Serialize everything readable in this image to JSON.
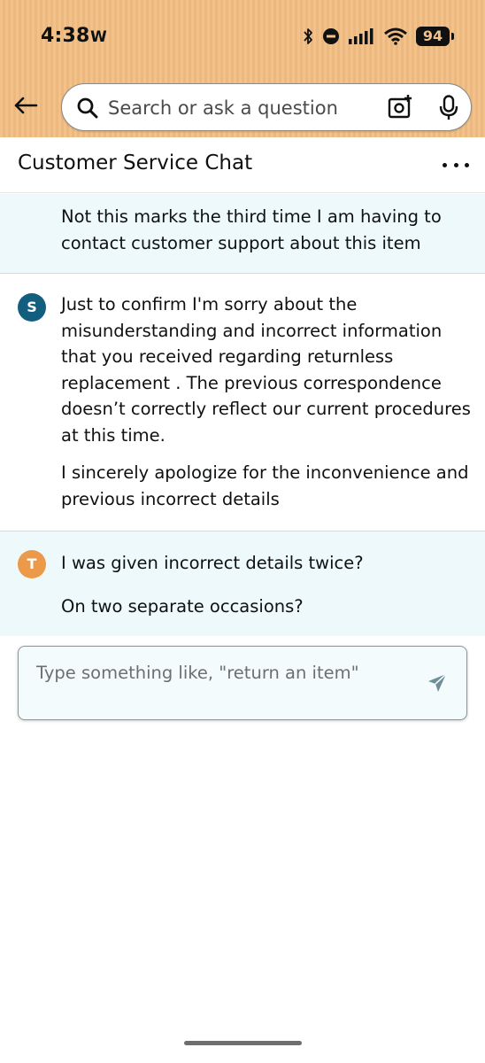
{
  "status_bar": {
    "time": "4:38",
    "extra_icon": "W",
    "battery": "94"
  },
  "search": {
    "placeholder": "Search or ask a question"
  },
  "chat": {
    "title": "Customer Service Chat",
    "messages": [
      {
        "sender": "customer",
        "paragraphs": [
          "Not this marks the third time I am having to contact customer support about this item"
        ]
      },
      {
        "sender": "agent",
        "avatar": "S",
        "paragraphs": [
          "Just to confirm I'm sorry about the misunderstanding and incorrect information that you received regarding returnless replacement . The previous correspondence doesn’t correctly reflect our current procedures at this time.",
          "I sincerely apologize for the inconvenience and previous incorrect details"
        ]
      },
      {
        "sender": "customer",
        "avatar": "T",
        "paragraphs": [
          "I was given incorrect details twice?",
          "On two separate occasions?"
        ]
      }
    ],
    "input_placeholder": "Type something like, \"return an item\""
  },
  "colors": {
    "header_band": "#f2c28a",
    "customer_bubble_bg": "#eef9fc",
    "agent_avatar": "#135d7f",
    "user_avatar": "#ec9a4a",
    "send_icon": "#6f8f99"
  },
  "icons": {
    "back": "arrow-left-icon",
    "search": "search-icon",
    "camera": "camera-scan-icon",
    "mic": "microphone-icon",
    "more": "more-horizontal-icon",
    "send": "send-icon"
  }
}
